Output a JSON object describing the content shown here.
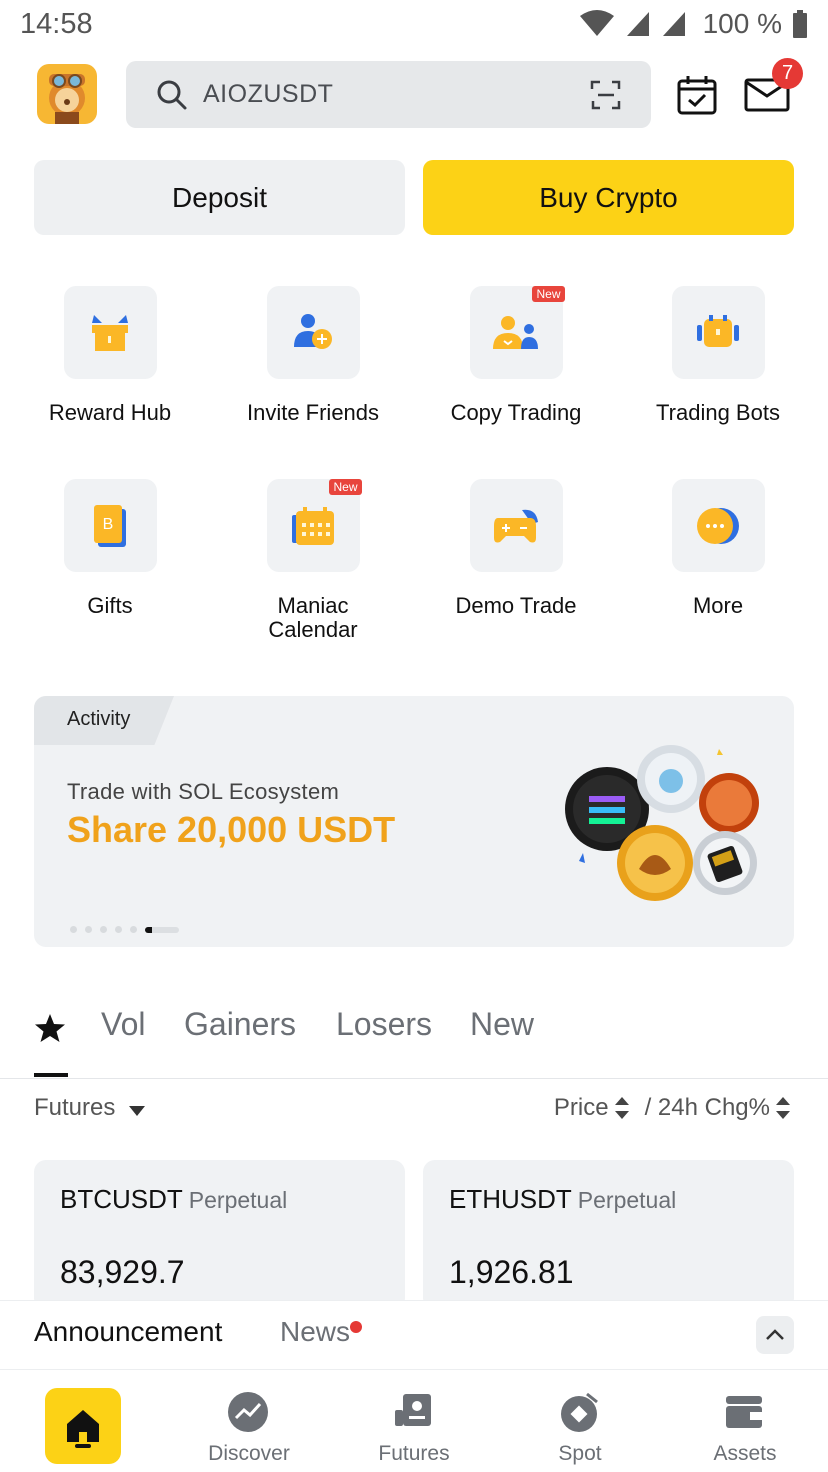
{
  "status_bar": {
    "time": "14:58",
    "battery": "100 %"
  },
  "header": {
    "search_value": "AIOZUSDT",
    "mail_badge": "7"
  },
  "actions": {
    "deposit": "Deposit",
    "buy_crypto": "Buy Crypto"
  },
  "shortcuts": [
    {
      "label": "Reward Hub",
      "icon": "gift-box-icon"
    },
    {
      "label": "Invite Friends",
      "icon": "add-user-icon"
    },
    {
      "label": "Copy Trading",
      "icon": "copy-trading-icon",
      "badge": "New"
    },
    {
      "label": "Trading Bots",
      "icon": "robot-icon"
    },
    {
      "label": "Gifts",
      "icon": "gift-card-icon"
    },
    {
      "label": "Maniac Calendar",
      "icon": "calendar-icon",
      "badge": "New"
    },
    {
      "label": "Demo Trade",
      "icon": "gamepad-icon"
    },
    {
      "label": "More",
      "icon": "more-icon"
    }
  ],
  "banner": {
    "tag": "Activity",
    "subtitle": "Trade with SOL Ecosystem",
    "headline": "Share 20,000 USDT",
    "slide_index": 6,
    "slide_count": 6
  },
  "market_tabs": [
    "Vol",
    "Gainers",
    "Losers",
    "New"
  ],
  "filter": {
    "market": "Futures",
    "sort_price": "Price",
    "sort_change": "/ 24h Chg%"
  },
  "cards": [
    {
      "symbol": "BTCUSDT",
      "type": "Perpetual",
      "price": "83,929.7"
    },
    {
      "symbol": "ETHUSDT",
      "type": "Perpetual",
      "price": "1,926.81"
    }
  ],
  "announcement": {
    "label": "Announcement",
    "news": "News"
  },
  "bottom_nav": [
    {
      "label": "",
      "icon": "home-icon"
    },
    {
      "label": "Discover",
      "icon": "discover-icon"
    },
    {
      "label": "Futures",
      "icon": "futures-icon"
    },
    {
      "label": "Spot",
      "icon": "spot-icon"
    },
    {
      "label": "Assets",
      "icon": "wallet-icon"
    }
  ],
  "colors": {
    "accent": "#fcd216",
    "headline": "#f0a21b",
    "badge": "#e53935",
    "icon_blue": "#2f6fe0"
  }
}
